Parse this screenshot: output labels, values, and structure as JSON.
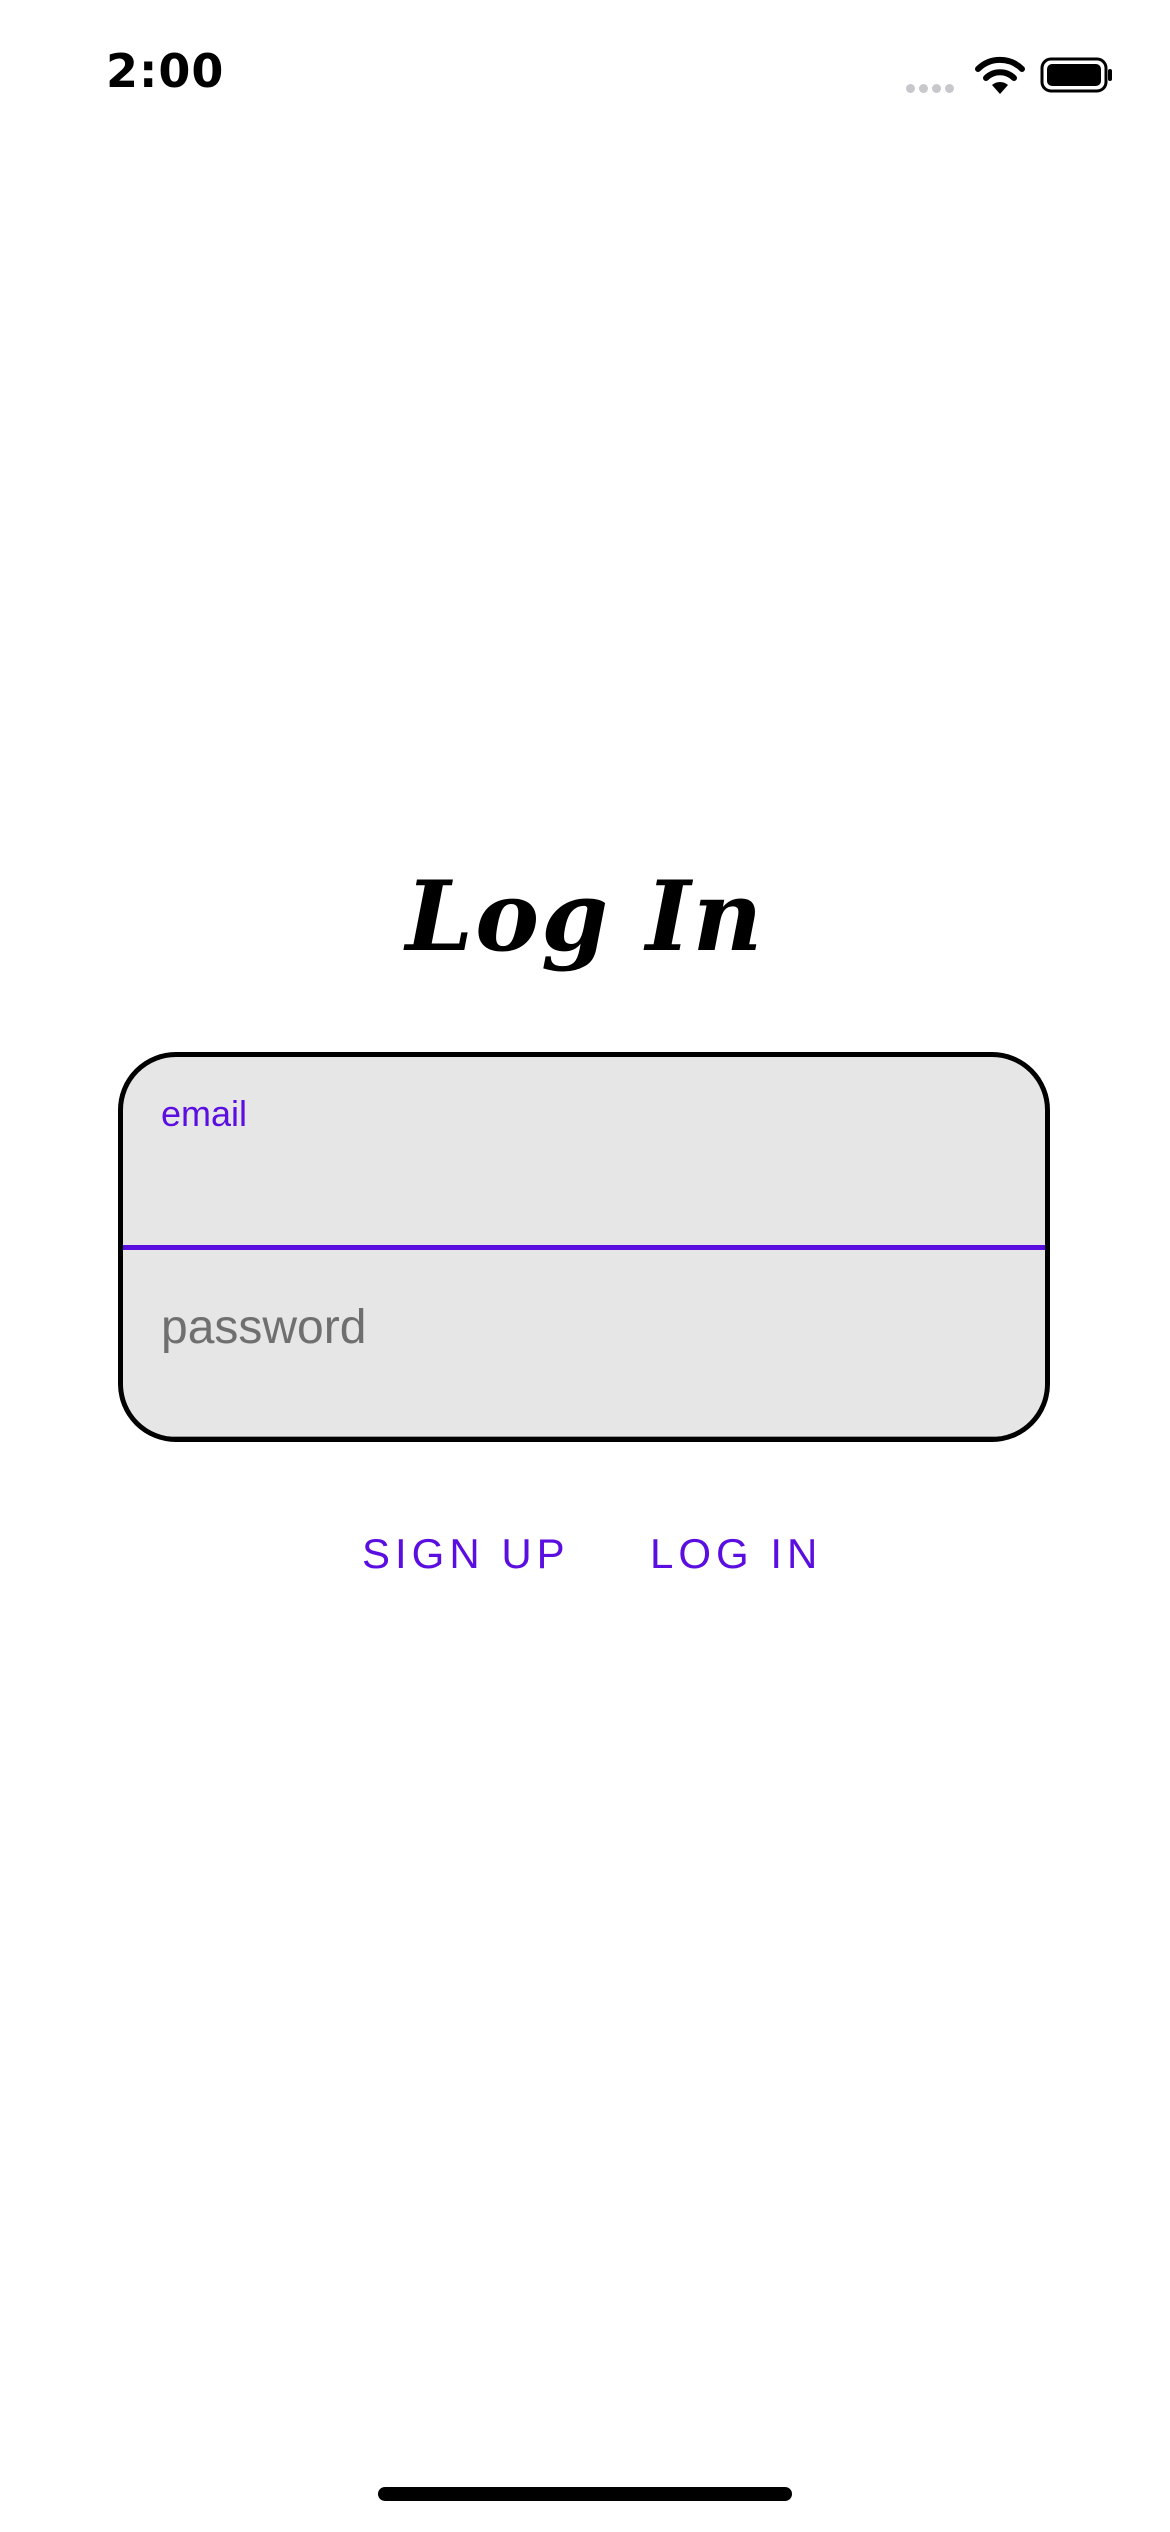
{
  "status_bar": {
    "time": "2:00"
  },
  "screen": {
    "title": "Log In"
  },
  "form": {
    "email_label": "email",
    "password_placeholder": "password"
  },
  "actions": {
    "sign_up_label": "SIGN UP",
    "log_in_label": "LOG IN"
  },
  "colors": {
    "accent": "#5b0ee0",
    "field_background": "#e6e6e6",
    "border": "#000000"
  }
}
